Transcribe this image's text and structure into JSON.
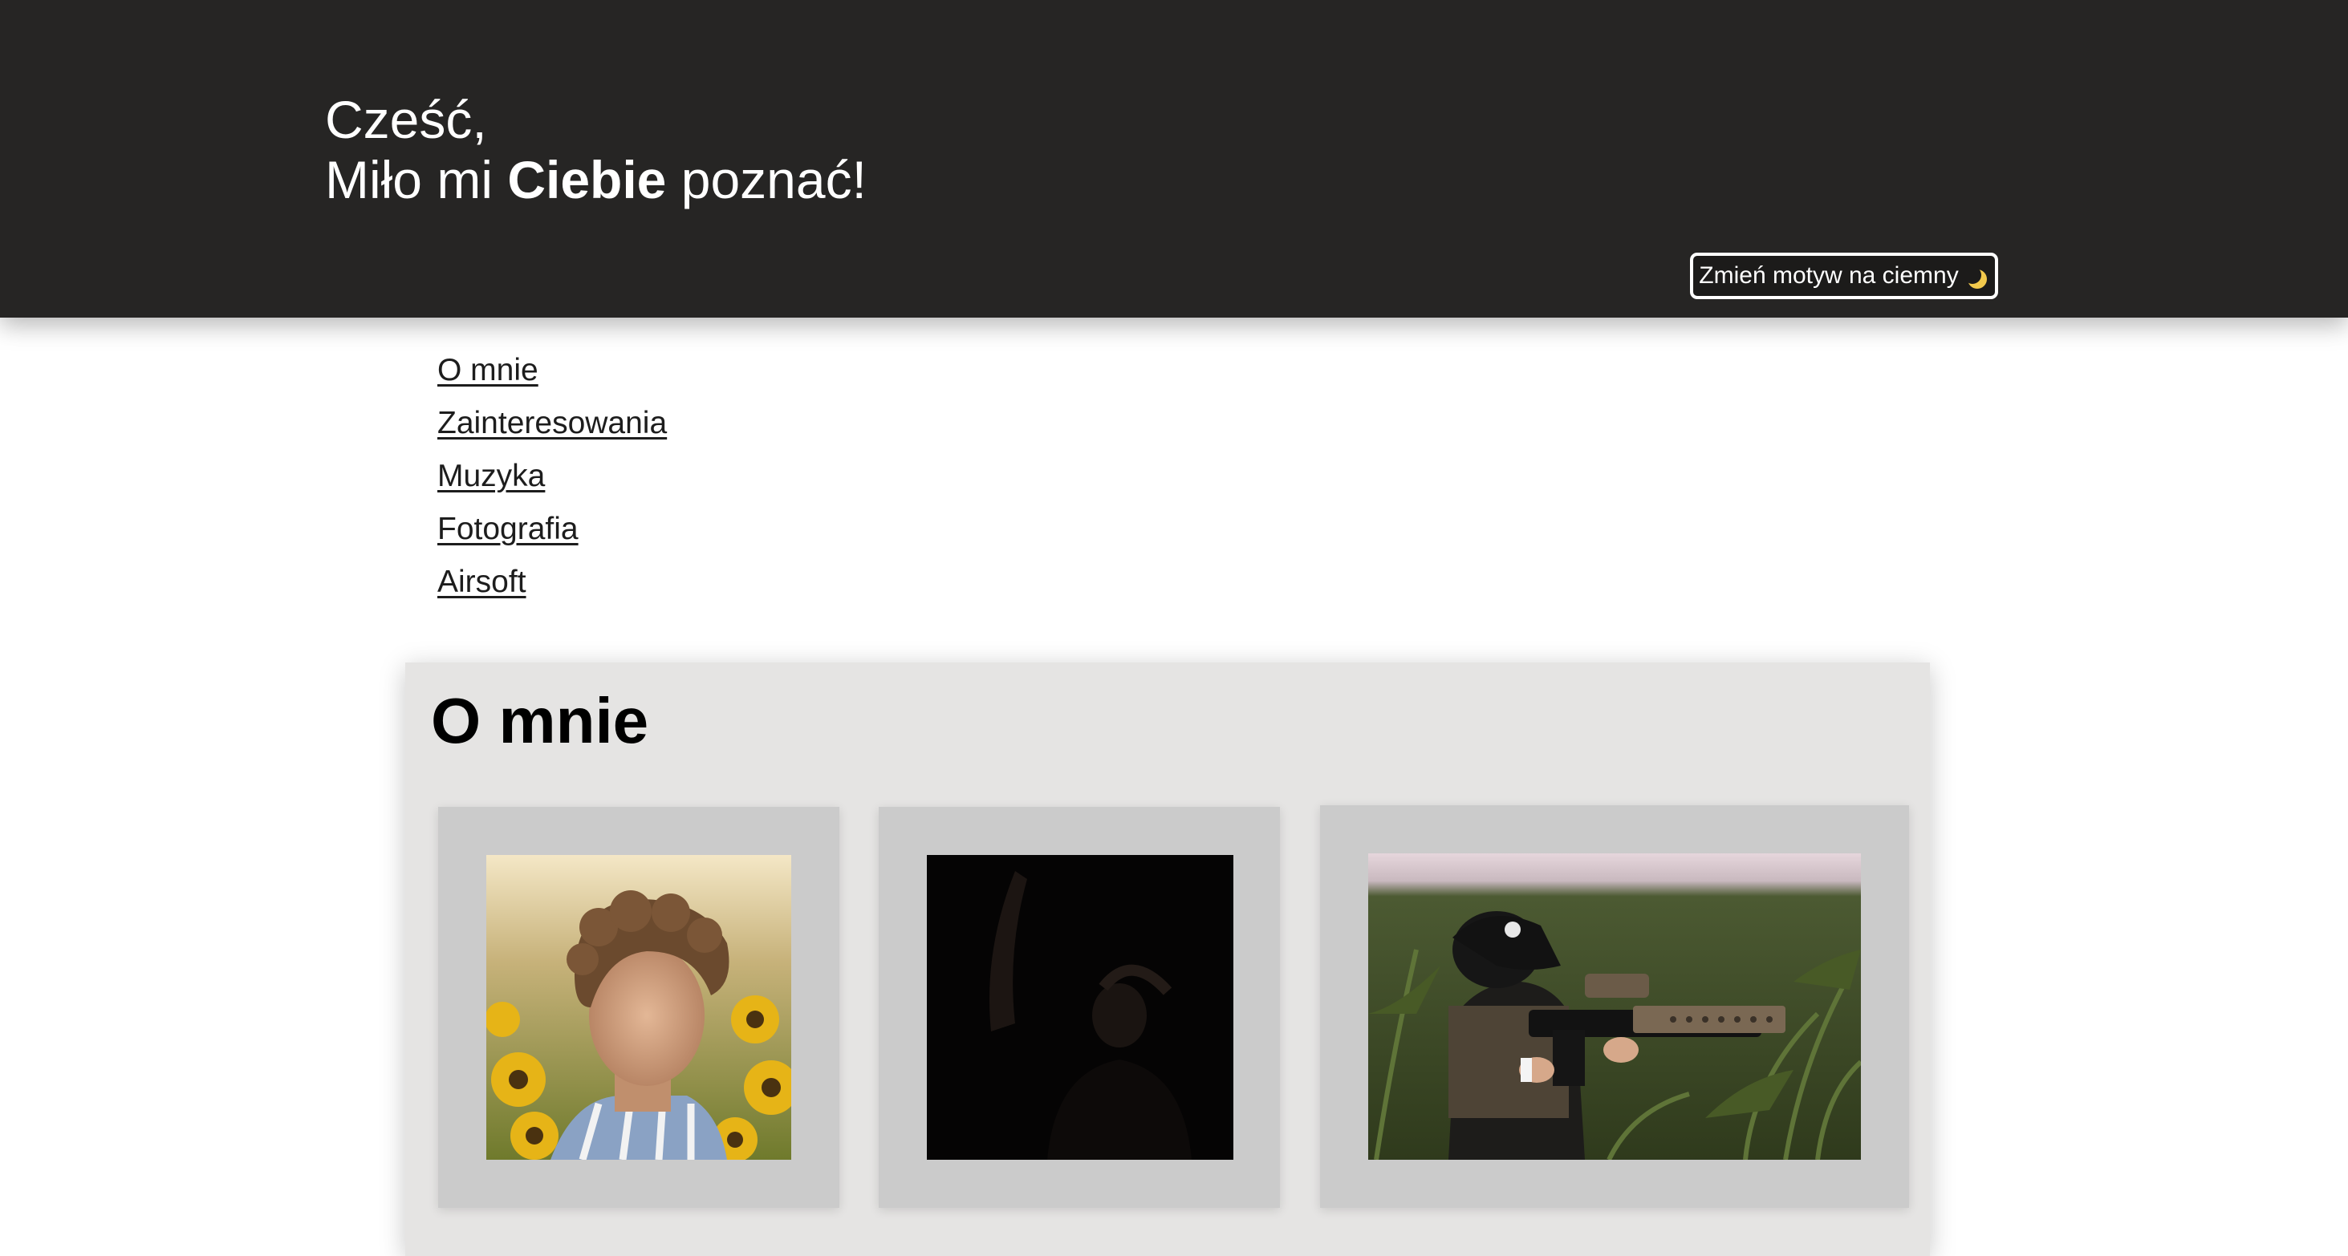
{
  "header": {
    "greeting_line1": "Cześć,",
    "greeting_line2_prefix": "Miło mi ",
    "greeting_line2_bold": "Ciebie",
    "greeting_line2_suffix": " poznać!",
    "theme_button_label": "Zmień motyw na ciemny",
    "theme_button_icon": "moon-icon"
  },
  "nav": {
    "items": [
      {
        "label": "O mnie"
      },
      {
        "label": "Zainteresowania"
      },
      {
        "label": "Muzyka"
      },
      {
        "label": "Fotografia"
      },
      {
        "label": "Airsoft"
      }
    ]
  },
  "about": {
    "title": "O mnie",
    "photos": [
      {
        "icon": "portrait-photo"
      },
      {
        "icon": "dark-portrait-photo"
      },
      {
        "icon": "airsoft-photo"
      }
    ]
  },
  "colors": {
    "header_bg": "#262524",
    "section_bg": "#e5e4e3",
    "card_bg": "#cbcbcb",
    "link": "#1d1d1d"
  }
}
